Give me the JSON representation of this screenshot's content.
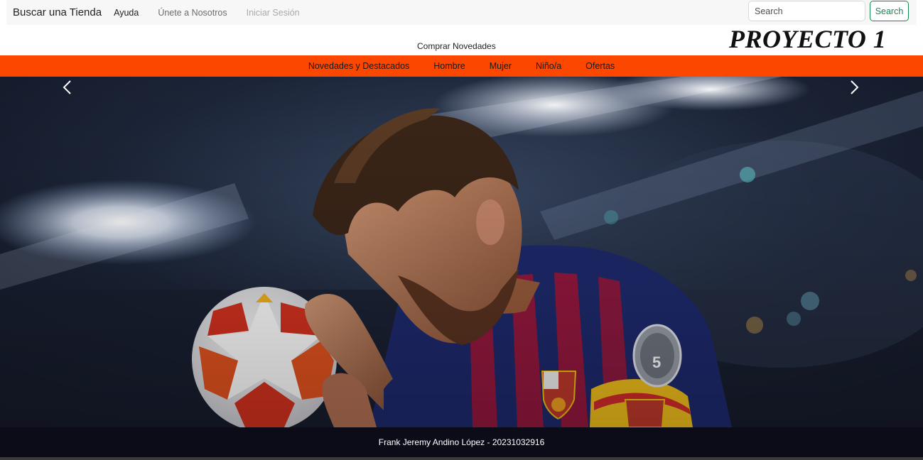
{
  "navbar": {
    "brand": "Buscar una Tienda",
    "links": [
      "Ayuda",
      "Únete a Nosotros",
      "Iniciar Sesión"
    ],
    "search_placeholder": "Search",
    "search_button": "Search"
  },
  "promo": {
    "link": "Comprar Novedades",
    "project_title": "PROYECTO 1"
  },
  "categories": [
    "Novedades y Destacados",
    "Hombre",
    "Mujer",
    "Niño/a",
    "Ofertas"
  ],
  "carousel": {
    "prev_icon": "chevron-left-icon",
    "next_icon": "chevron-right-icon",
    "badge_number": "5"
  },
  "footer": {
    "text": "Frank Jeremy Andino López - 20231032916"
  },
  "colors": {
    "category_bar": "#fb4700",
    "footer_bg": "#0b0c18",
    "search_button": "#198754"
  }
}
